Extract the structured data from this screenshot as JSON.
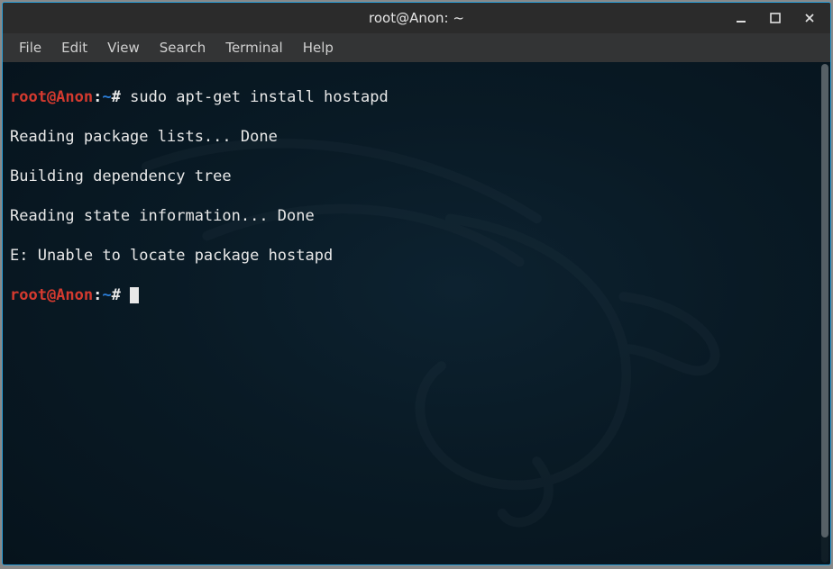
{
  "window": {
    "title": "root@Anon: ~"
  },
  "menubar": {
    "items": [
      "File",
      "Edit",
      "View",
      "Search",
      "Terminal",
      "Help"
    ]
  },
  "prompt": {
    "user_host": "root@Anon",
    "separator": ":",
    "path": "~",
    "symbol": "#"
  },
  "terminal": {
    "command1": "sudo apt-get install hostapd",
    "output": [
      "Reading package lists... Done",
      "Building dependency tree",
      "Reading state information... Done",
      "E: Unable to locate package hostapd"
    ]
  },
  "icons": {
    "minimize": "minimize-icon",
    "maximize": "maximize-icon",
    "close": "close-icon"
  },
  "colors": {
    "prompt_user": "#d43a2f",
    "prompt_path": "#2b7ed8",
    "text": "#e8e8e8",
    "window_border": "#2b9fd9",
    "titlebar_bg": "#2b2b2b",
    "menubar_bg": "#333435",
    "term_bg": "#0a1820"
  }
}
